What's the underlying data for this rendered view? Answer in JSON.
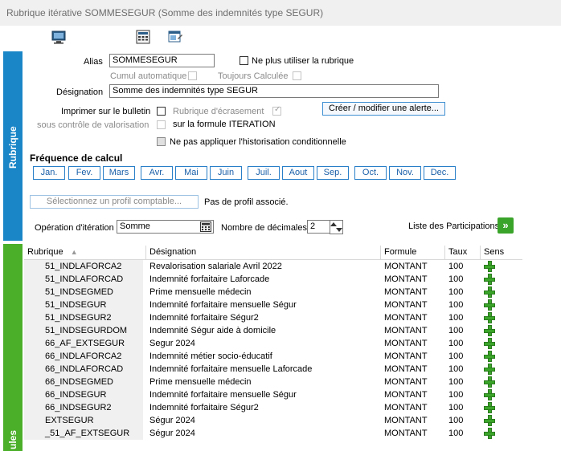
{
  "window": {
    "title": "Rubrique itérative SOMMESEGUR (Somme des indemnités type SEGUR)"
  },
  "toolbar": {
    "icons": [
      "monitor-icon",
      "calculator-icon",
      "window-edit-icon"
    ]
  },
  "side": {
    "rubrique": "Rubrique",
    "cumuls": "ules"
  },
  "form": {
    "alias_label": "Alias",
    "alias_value": "SOMMESEGUR",
    "ne_plus_utiliser": "Ne plus utiliser la rubrique",
    "cumul_auto": "Cumul automatique",
    "toujours_calculee": "Toujours Calculée",
    "designation_label": "Désignation",
    "designation_value": "Somme des indemnités type SEGUR",
    "imprimer_label": "Imprimer sur le bulletin",
    "sous_controle_label": "sous contrôle de valorisation",
    "rubrique_ecrasement": "Rubrique d'écrasement",
    "formule_iteration": "sur la formule ITERATION",
    "alerte_button": "Créer / modifier une alerte...",
    "historisation": "Ne pas appliquer l'historisation conditionnelle"
  },
  "frequence": {
    "title": "Fréquence de calcul",
    "months": [
      "Jan.",
      "Fev.",
      "Mars",
      "Avr.",
      "Mai",
      "Juin",
      "Juil.",
      "Aout",
      "Sep.",
      "Oct.",
      "Nov.",
      "Dec."
    ]
  },
  "profil": {
    "button": "Sélectionnez un profil comptable...",
    "status": "Pas de profil associé."
  },
  "iteration": {
    "operation_label": "Opération d'itération",
    "operation_value": "Somme",
    "decimales_label": "Nombre de décimales",
    "decimales_value": "2",
    "participations": "Liste des Participations",
    "participations_arrow": "»"
  },
  "table": {
    "headers": {
      "rubrique": "Rubrique",
      "designation": "Désignation",
      "formule": "Formule",
      "taux": "Taux",
      "sens": "Sens"
    },
    "rows": [
      {
        "rubrique": "51_INDLAFORCA2",
        "designation": "Revalorisation salariale Avril 2022",
        "formule": "MONTANT",
        "taux": "100"
      },
      {
        "rubrique": "51_INDLAFORCAD",
        "designation": "Indemnité forfaitaire Laforcade",
        "formule": "MONTANT",
        "taux": "100"
      },
      {
        "rubrique": "51_INDSEGMED",
        "designation": "Prime mensuelle médecin",
        "formule": "MONTANT",
        "taux": "100"
      },
      {
        "rubrique": "51_INDSEGUR",
        "designation": "Indemnité forfaitaire mensuelle Ségur",
        "formule": "MONTANT",
        "taux": "100"
      },
      {
        "rubrique": "51_INDSEGUR2",
        "designation": "Indemnité forfaitaire Ségur2",
        "formule": "MONTANT",
        "taux": "100"
      },
      {
        "rubrique": "51_INDSEGURDOM",
        "designation": "Indemnité Ségur aide à domicile",
        "formule": "MONTANT",
        "taux": "100"
      },
      {
        "rubrique": "66_AF_EXTSEGUR",
        "designation": "Segur 2024",
        "formule": "MONTANT",
        "taux": "100"
      },
      {
        "rubrique": "66_INDLAFORCA2",
        "designation": "Indemnité métier socio-éducatif",
        "formule": "MONTANT",
        "taux": "100"
      },
      {
        "rubrique": "66_INDLAFORCAD",
        "designation": "Indemnité forfaitaire mensuelle Laforcade",
        "formule": "MONTANT",
        "taux": "100"
      },
      {
        "rubrique": "66_INDSEGMED",
        "designation": "Prime mensuelle médecin",
        "formule": "MONTANT",
        "taux": "100"
      },
      {
        "rubrique": "66_INDSEGUR",
        "designation": "Indemnité forfaitaire mensuelle Ségur",
        "formule": "MONTANT",
        "taux": "100"
      },
      {
        "rubrique": "66_INDSEGUR2",
        "designation": "Indemnité forfaitaire Ségur2",
        "formule": "MONTANT",
        "taux": "100"
      },
      {
        "rubrique": "EXTSEGUR",
        "designation": "Ségur 2024",
        "formule": "MONTANT",
        "taux": "100"
      },
      {
        "rubrique": "_51_AF_EXTSEGUR",
        "designation": "Ségur 2024",
        "formule": "MONTANT",
        "taux": "100"
      }
    ]
  }
}
